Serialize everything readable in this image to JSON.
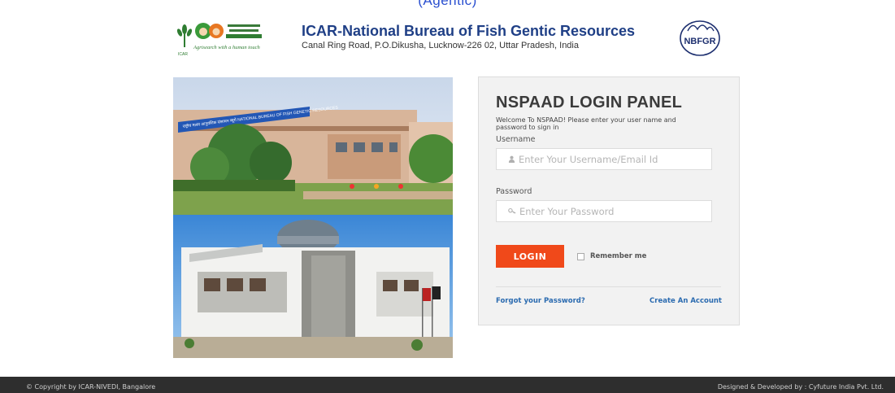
{
  "top_banner_partial": "(Agentic)",
  "header": {
    "title": "ICAR-National Bureau of Fish Gentic Resources",
    "address": "Canal Ring Road, P.O.Dikusha, Lucknow-226 02, Uttar Pradesh, India",
    "icar_logo": {
      "tagline": "Agrisearch with a human touch",
      "caption": "ICAR"
    },
    "nbfgr_logo_text": "NBFGR"
  },
  "photos": {
    "top_signboard": "राष्ट्रीय मत्स्य आनुवंशिक संसाधन ब्यूरो NATIONAL BUREAU OF FISH GENETIC RESOURCES"
  },
  "login": {
    "title": "NSPAAD LOGIN PANEL",
    "welcome": "Welcome To NSPAAD! Please enter your user name and password to sign in",
    "username_label": "Username",
    "username_placeholder": "Enter Your Username/Email Id",
    "password_label": "Password",
    "password_placeholder": "Enter Your Password",
    "login_button": "LOGIN",
    "remember_label": "Remember me",
    "forgot_link": "Forgot your Password?",
    "create_link": "Create An Account"
  },
  "footer": {
    "copyright": "© Copyright by ICAR-NIVEDI, Bangalore",
    "designed": "Designed & Developed by : Cyfuture India Pvt. Ltd."
  },
  "colors": {
    "accent": "#f0491a",
    "title_blue": "#1f3f86",
    "link_blue": "#2b6bb0",
    "footer_bg": "#2e2e2e"
  }
}
